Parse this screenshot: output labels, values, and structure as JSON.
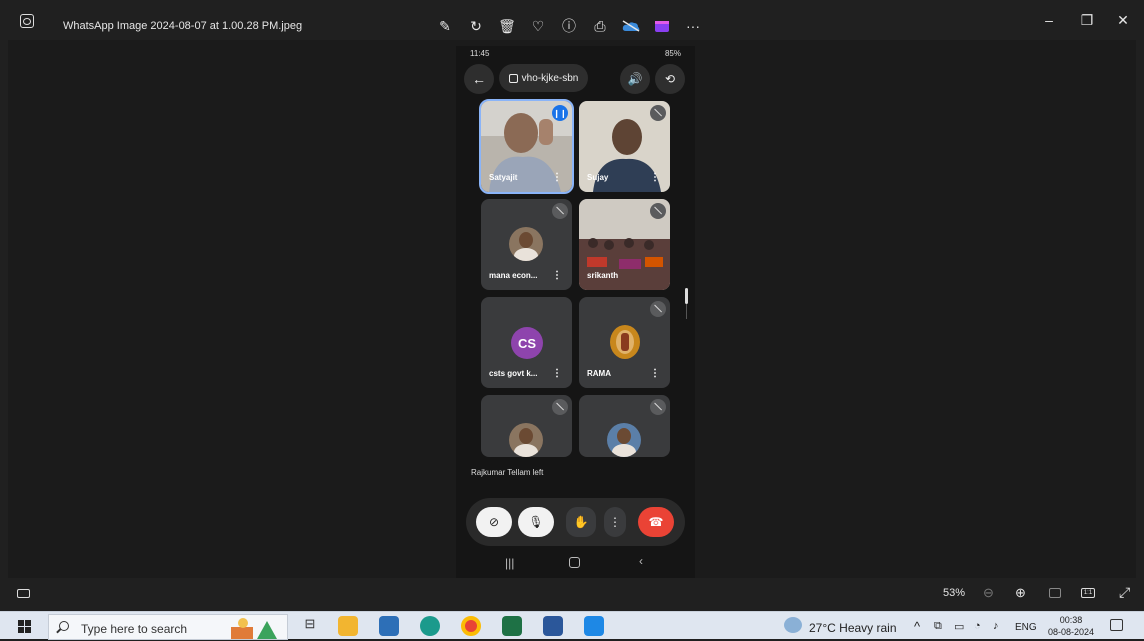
{
  "window": {
    "title": "WhatsApp Image 2024-08-07 at 1.00.28 PM.jpeg",
    "toolbar_icons": [
      "edit-icon",
      "rotate-icon",
      "delete-icon",
      "favorite-icon",
      "info-icon",
      "print-icon",
      "onedrive-icon",
      "clipchamp-icon",
      "more-icon"
    ],
    "more_label": "···"
  },
  "phone": {
    "status_time": "11:45",
    "status_battery": "85%",
    "meeting_code": "vho-kjke-sbn",
    "participants": [
      {
        "name": "Satyajit",
        "speaking": true,
        "type": "video"
      },
      {
        "name": "Sujay",
        "muted": true,
        "type": "video"
      },
      {
        "name": "mana econ...",
        "muted": true,
        "type": "avatar"
      },
      {
        "name": "srikanth",
        "muted": true,
        "type": "video"
      },
      {
        "name": "csts govt k...",
        "initials": "CS",
        "muted": true,
        "type": "initials"
      },
      {
        "name": "RAMA",
        "muted": true,
        "type": "avatar"
      },
      {
        "name": "",
        "muted": true,
        "type": "avatar"
      },
      {
        "name": "",
        "muted": true,
        "type": "avatar"
      }
    ],
    "notice": "Rajkumar Tellam left",
    "more_dots": "⋮"
  },
  "zoom": {
    "value": "53%"
  },
  "taskbar": {
    "search_placeholder": "Type here to search",
    "weather": "27°C  Heavy rain",
    "language": "ENG",
    "time": "00:38",
    "date": "08-08-2024"
  },
  "colors": {
    "accent": "#8ab4f8",
    "end_call": "#ea4335",
    "avatar_cs": "#8e44ad"
  }
}
